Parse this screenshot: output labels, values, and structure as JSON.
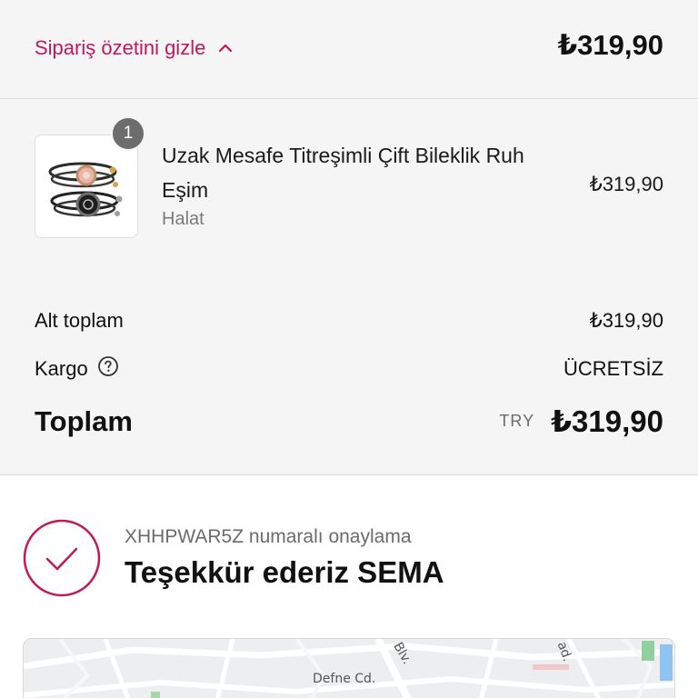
{
  "summary_toggle": {
    "label": "Sipariş özetini gizle",
    "total": "₺319,90"
  },
  "item": {
    "quantity": "1",
    "title": "Uzak Mesafe Titreşimli Çift Bileklik Ruh Eşim",
    "variant": "Halat",
    "price": "₺319,90",
    "image_icon": "bracelet-pair-image"
  },
  "totals": {
    "subtotal_label": "Alt toplam",
    "subtotal_value": "₺319,90",
    "shipping_label": "Kargo",
    "shipping_value": "ÜCRETSİZ",
    "total_label": "Toplam",
    "currency": "TRY",
    "total_value": "₺319,90"
  },
  "confirmation": {
    "number_text": "XHHPWAR5Z numaralı onaylama",
    "thanks_text": "Teşekkür ederiz SEMA"
  },
  "map": {
    "street_1": "Defne Cd.",
    "street_2": "Blv.",
    "street_3": "ad."
  },
  "colors": {
    "accent": "#c2185b",
    "summary_background": "#f5f5f5"
  }
}
